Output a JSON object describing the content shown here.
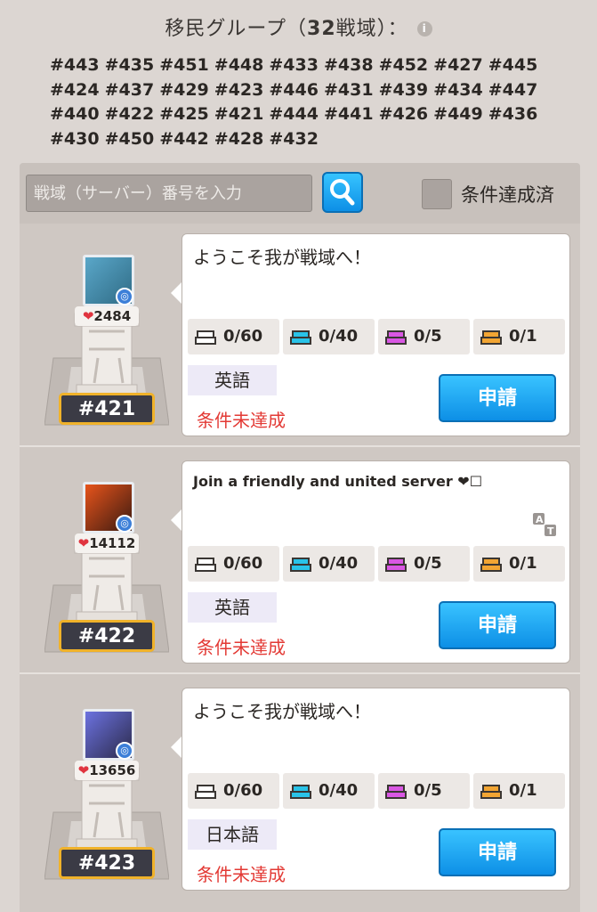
{
  "header": {
    "title_prefix": "移民グループ（",
    "title_count": "32",
    "title_suffix": "戦域）：",
    "info_icon": "i"
  },
  "server_list": [
    "#443",
    "#435",
    "#451",
    "#448",
    "#433",
    "#438",
    "#452",
    "#427",
    "#445",
    "#424",
    "#437",
    "#429",
    "#423",
    "#446",
    "#431",
    "#439",
    "#434",
    "#447",
    "#440",
    "#422",
    "#425",
    "#421",
    "#444",
    "#441",
    "#426",
    "#449",
    "#436",
    "#430",
    "#450",
    "#442",
    "#428",
    "#432"
  ],
  "search": {
    "placeholder": "戦域（サーバー）番号を入力",
    "checkbox_label": "条件達成済"
  },
  "rows": [
    {
      "likes": "2484",
      "server": "#421",
      "message": "ようこそ我が戦域へ！",
      "message_small": false,
      "show_translate": false,
      "slots": [
        "0/60",
        "0/40",
        "0/5",
        "0/1"
      ],
      "language": "英語",
      "status": "条件未達成",
      "apply": "申請",
      "avatar_colors": [
        "#5aa7c9",
        "#2f6b85"
      ]
    },
    {
      "likes": "14112",
      "server": "#422",
      "message": "Join a friendly and united server ❤☐",
      "message_small": true,
      "show_translate": true,
      "slots": [
        "0/60",
        "0/40",
        "0/5",
        "0/1"
      ],
      "language": "英語",
      "status": "条件未達成",
      "apply": "申請",
      "avatar_colors": [
        "#e7541c",
        "#3b1a10"
      ]
    },
    {
      "likes": "13656",
      "server": "#423",
      "message": "ようこそ我が戦域へ！",
      "message_small": false,
      "show_translate": false,
      "slots": [
        "0/60",
        "0/40",
        "0/5",
        "0/1"
      ],
      "language": "日本語",
      "status": "条件未達成",
      "apply": "申請",
      "avatar_colors": [
        "#6c72e0",
        "#2b2a4a"
      ]
    }
  ],
  "slot_colors": [
    "#ffffff",
    "#29c3e8",
    "#d957e3",
    "#f2a533"
  ],
  "colors": {
    "accent": "#1aa3f0",
    "warning": "#e33a35",
    "tag_border": "#f0b22a"
  }
}
